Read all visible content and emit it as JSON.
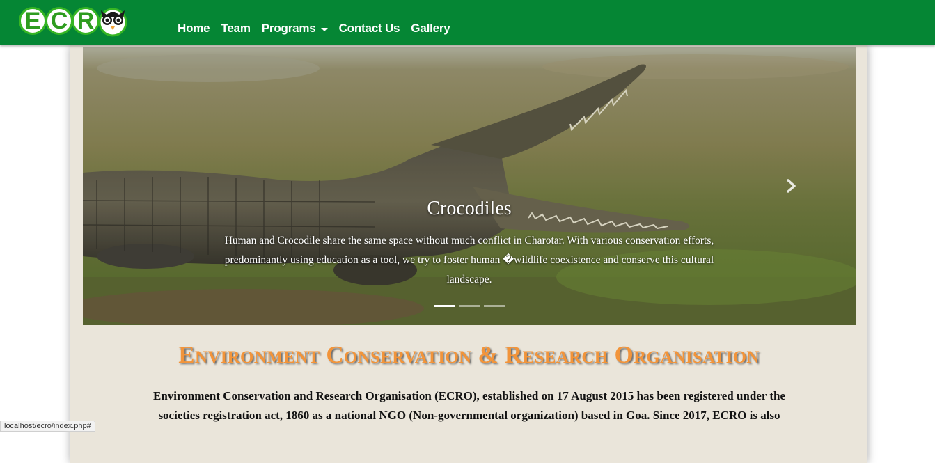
{
  "brand": {
    "logo_letters": [
      "E",
      "C",
      "R"
    ],
    "logo_alt": "ECRO"
  },
  "nav": {
    "items": [
      {
        "label": "Home"
      },
      {
        "label": "Team"
      },
      {
        "label": "Programs",
        "has_dropdown": true
      },
      {
        "label": "Contact Us"
      },
      {
        "label": "Gallery"
      }
    ]
  },
  "carousel": {
    "slide_title": "Crocodiles",
    "slide_text": "Human and Crocodile share the same space without much conflict in Charotar. With various conservation efforts, predominantly using education as a tool, we try to foster human �wildlife coexistence and conserve this cultural landscape.",
    "indicator_count": 3,
    "active_indicator": 0,
    "next_icon": "chevron-right-icon"
  },
  "main": {
    "heading": "Environment Conservation & Research Organisation",
    "intro_line1": "Environment Conservation and Research Organisation (ECRO), established on 17 August 2015 has been registered under the",
    "intro_line2": "societies registration act, 1860 as a national NGO (Non-governmental organization) based in Goa. Since 2017, ECRO is also"
  },
  "status_bar": {
    "url": "localhost/ecro/index.php#"
  },
  "colors": {
    "navbar": "#058634",
    "heading": "#f2943a",
    "container_bg": "#eae5da"
  }
}
